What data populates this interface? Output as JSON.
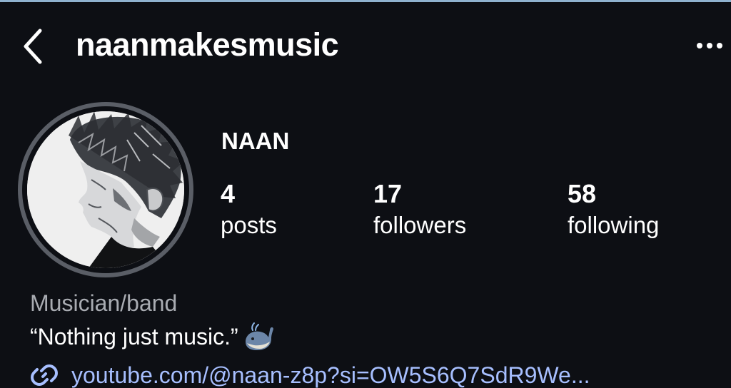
{
  "header": {
    "back_icon": "chevron-left-icon",
    "username": "naanmakesmusic",
    "more_icon": "more-horizontal-icon"
  },
  "profile": {
    "display_name": "NAAN",
    "stats": {
      "posts": {
        "count": "4",
        "label": "posts"
      },
      "followers": {
        "count": "17",
        "label": "followers"
      },
      "following": {
        "count": "58",
        "label": "following"
      }
    },
    "category": "Musician/band",
    "bio": "“Nothing just music.”",
    "bio_emoji": "whale-icon",
    "link": "youtube.com/@naan-z8p?si=OW5S6Q7SdR9We..."
  },
  "colors": {
    "background": "#0d0f14",
    "text": "#ffffff",
    "category_text": "#a9acb2",
    "link": "#a7bfff",
    "avatar_ring": "#5a5e66"
  }
}
